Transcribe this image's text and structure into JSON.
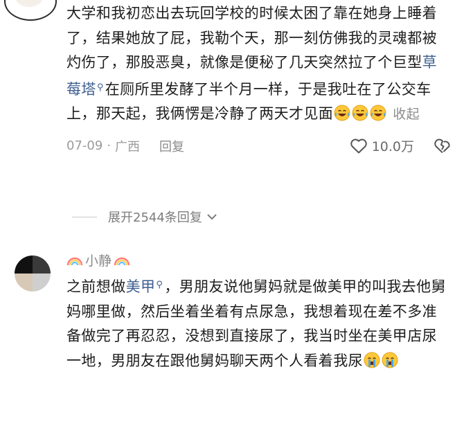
{
  "comment1": {
    "segments": [
      {
        "type": "text",
        "value": "大学和我初恋出去玩回学校的时候太困了靠在她身上睡着了，结果她放了屁，我勒个天，那一刻仿佛我的灵魂都被灼伤了，那股恶臭，就像是便秘了几天突然拉了个巨型"
      },
      {
        "type": "keyword",
        "value": "草莓塔",
        "icon": "search-icon"
      },
      {
        "type": "text",
        "value": "在厕所里发酵了半个月一样，于是我吐在了公交车上，那天起，我俩愣是冷静了两天才见面"
      }
    ],
    "emojis": [
      "laughing-crying-emoji",
      "laughing-crying-emoji",
      "laughing-crying-emoji"
    ],
    "collapse_label": "收起",
    "date": "07-09",
    "separator": "·",
    "location": "广西",
    "reply_label": "回复",
    "like_count": "10.0万"
  },
  "expand_replies": {
    "label": "展开2544条回复"
  },
  "comment2": {
    "username": "小静",
    "segments": [
      {
        "type": "text",
        "value": "之前想做"
      },
      {
        "type": "keyword",
        "value": "美甲",
        "icon": "search-icon"
      },
      {
        "type": "text",
        "value": "，男朋友说他舅妈就是做美甲的叫我去他舅妈哪里做，然后坐着坐着有点尿急，我想着现在差不多准备做完了再忍忍，没想到直接尿了，我当时坐在美甲店尿一地，男朋友在跟他舅妈聊天两个人看着我尿"
      }
    ],
    "emojis": [
      "loudly-crying-emoji",
      "loudly-crying-emoji"
    ]
  },
  "colors": {
    "keyword": "#3d5f8f",
    "meta": "#9b9b9b",
    "text": "#1d1d1d"
  }
}
